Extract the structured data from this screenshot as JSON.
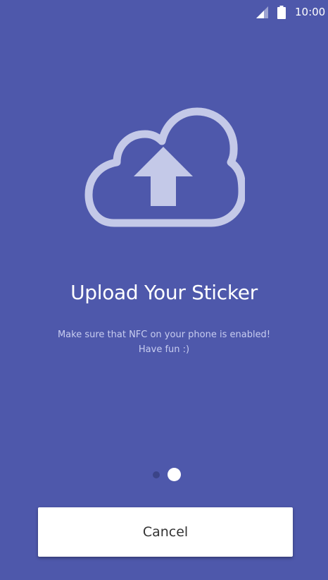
{
  "status_bar": {
    "time": "10:00",
    "icons": [
      "signal-icon",
      "battery-icon"
    ]
  },
  "hero": {
    "icon": "cloud-upload-icon",
    "title": "Upload Your Sticker",
    "description_line1": "Make sure that NFC on your phone is enabled!",
    "description_line2": "Have fun :)"
  },
  "pager": {
    "page_count": 2,
    "current_page": 2
  },
  "actions": {
    "cancel_label": "Cancel"
  },
  "colors": {
    "background": "#4e58ab",
    "icon_tint": "#c4c9e8",
    "dot_inactive": "#3b4488",
    "dot_active": "#ffffff"
  }
}
